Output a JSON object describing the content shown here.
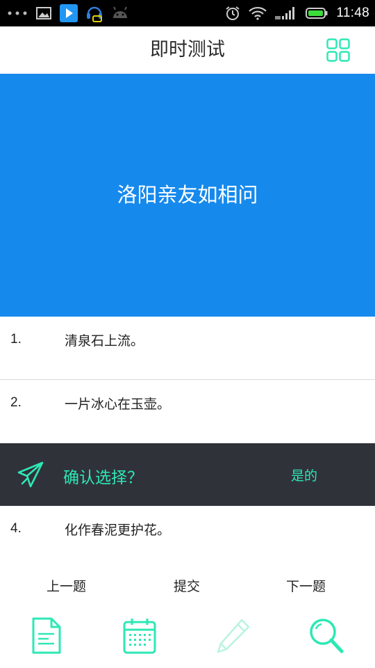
{
  "status_bar": {
    "time": "11:48",
    "icons": [
      "more-dots-icon",
      "image-icon",
      "play-store-icon",
      "headset-icon",
      "android-icon",
      "alarm-icon",
      "wifi-icon",
      "signal-icon",
      "battery-icon"
    ]
  },
  "header": {
    "title": "即时测试",
    "grid_icon": "grid-icon"
  },
  "question": {
    "text": "洛阳亲友如相问"
  },
  "options": [
    {
      "num": "1.",
      "text": "清泉石上流。"
    },
    {
      "num": "2.",
      "text": "一片冰心在玉壶。"
    },
    {
      "num": "4.",
      "text": "化作春泥更护花。"
    }
  ],
  "confirm": {
    "question": "确认选择？",
    "yes_label": "是的",
    "icon": "paper-plane-icon"
  },
  "nav": {
    "prev": "上一题",
    "submit": "提交",
    "next": "下一题"
  },
  "tabs": [
    "document-icon",
    "calendar-icon",
    "pencil-icon",
    "search-icon"
  ],
  "colors": {
    "accent": "#2de8b5",
    "banner": "#1689ec",
    "confirm_bg": "#30323a"
  }
}
